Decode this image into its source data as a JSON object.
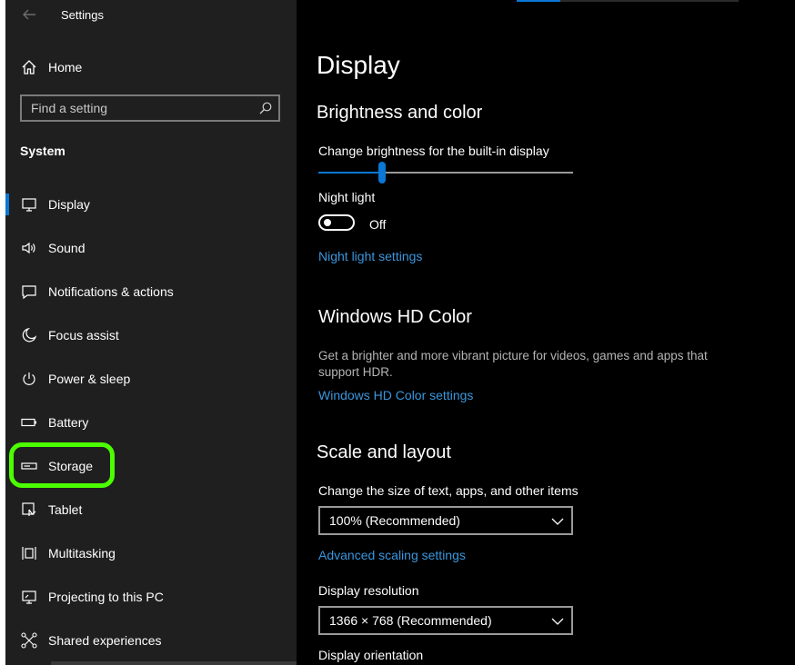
{
  "app": {
    "title": "Settings"
  },
  "sidebar": {
    "home_label": "Home",
    "search_placeholder": "Find a setting",
    "section": "System",
    "items": [
      {
        "label": "Display",
        "icon": "monitor-icon"
      },
      {
        "label": "Sound",
        "icon": "speaker-icon"
      },
      {
        "label": "Notifications & actions",
        "icon": "notification-icon"
      },
      {
        "label": "Focus assist",
        "icon": "moon-icon"
      },
      {
        "label": "Power & sleep",
        "icon": "power-icon"
      },
      {
        "label": "Battery",
        "icon": "battery-icon"
      },
      {
        "label": "Storage",
        "icon": "storage-icon"
      },
      {
        "label": "Tablet",
        "icon": "tablet-icon"
      },
      {
        "label": "Multitasking",
        "icon": "multitasking-icon"
      },
      {
        "label": "Projecting to this PC",
        "icon": "projecting-icon"
      },
      {
        "label": "Shared experiences",
        "icon": "shared-icon"
      }
    ],
    "selected": "Display",
    "highlighted": "Storage"
  },
  "main": {
    "title": "Display",
    "brightness": {
      "heading": "Brightness and color",
      "slider_label": "Change brightness for the built-in display",
      "slider_value": 0.25,
      "nightlight_label": "Night light",
      "toggle_state": "Off",
      "nightlight_link": "Night light settings"
    },
    "hdcolor": {
      "heading": "Windows HD Color",
      "description": "Get a brighter and more vibrant picture for videos, games and apps that support HDR.",
      "link": "Windows HD Color settings"
    },
    "scale": {
      "heading": "Scale and layout",
      "size_label": "Change the size of text, apps, and other items",
      "size_value": "100% (Recommended)",
      "advanced_link": "Advanced scaling settings",
      "resolution_label": "Display resolution",
      "resolution_value": "1366 × 768 (Recommended)",
      "orientation_label": "Display orientation"
    }
  },
  "colors": {
    "accent": "#0a78d4",
    "link": "#3a96dd",
    "highlight": "#4cff00",
    "sidebar_bg": "#1f1f1f"
  }
}
